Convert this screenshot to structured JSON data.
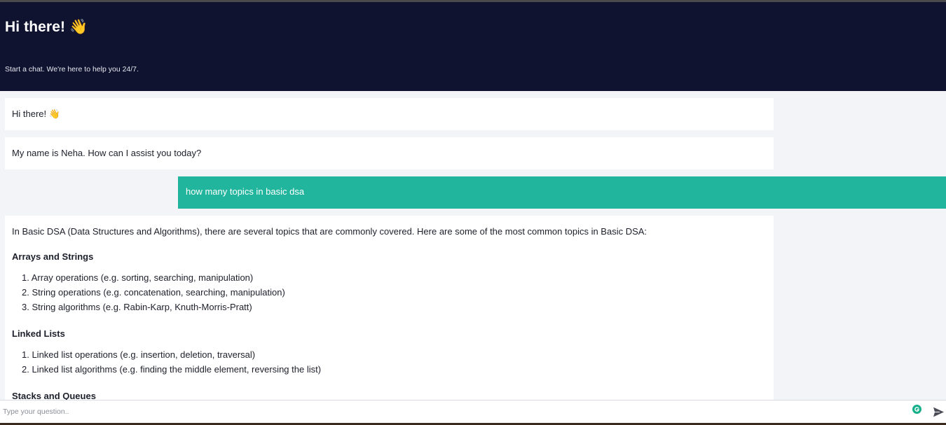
{
  "header": {
    "title": "Hi there! 👋",
    "subtitle": "Start a chat. We're here to help you 24/7."
  },
  "messages": [
    {
      "role": "bot",
      "text": "Hi there! 👋"
    },
    {
      "role": "bot",
      "text": "My name is Neha. How can I assist you today?"
    },
    {
      "role": "user",
      "text": "how many topics in basic dsa"
    },
    {
      "role": "bot",
      "intro": "In Basic DSA (Data Structures and Algorithms), there are several topics that are commonly covered. Here are some of the most common topics in Basic DSA:",
      "sections": [
        {
          "heading": "Arrays and Strings",
          "items": [
            "1. Array operations (e.g. sorting, searching, manipulation)",
            "2. String operations (e.g. concatenation, searching, manipulation)",
            "3. String algorithms (e.g. Rabin-Karp, Knuth-Morris-Pratt)"
          ]
        },
        {
          "heading": "Linked Lists",
          "items": [
            "1. Linked list operations (e.g. insertion, deletion, traversal)",
            "2. Linked list algorithms (e.g. finding the middle element, reversing the list)"
          ]
        },
        {
          "heading": "Stacks and Queues",
          "items": []
        }
      ]
    }
  ],
  "composer": {
    "placeholder": "Type your question..",
    "value": ""
  },
  "icons": {
    "send": "send-icon",
    "grammarly": "grammarly-icon"
  },
  "colors": {
    "header_bg": "#0f1330",
    "user_bubble": "#22b59e",
    "page_bg": "#f3f4f7"
  }
}
